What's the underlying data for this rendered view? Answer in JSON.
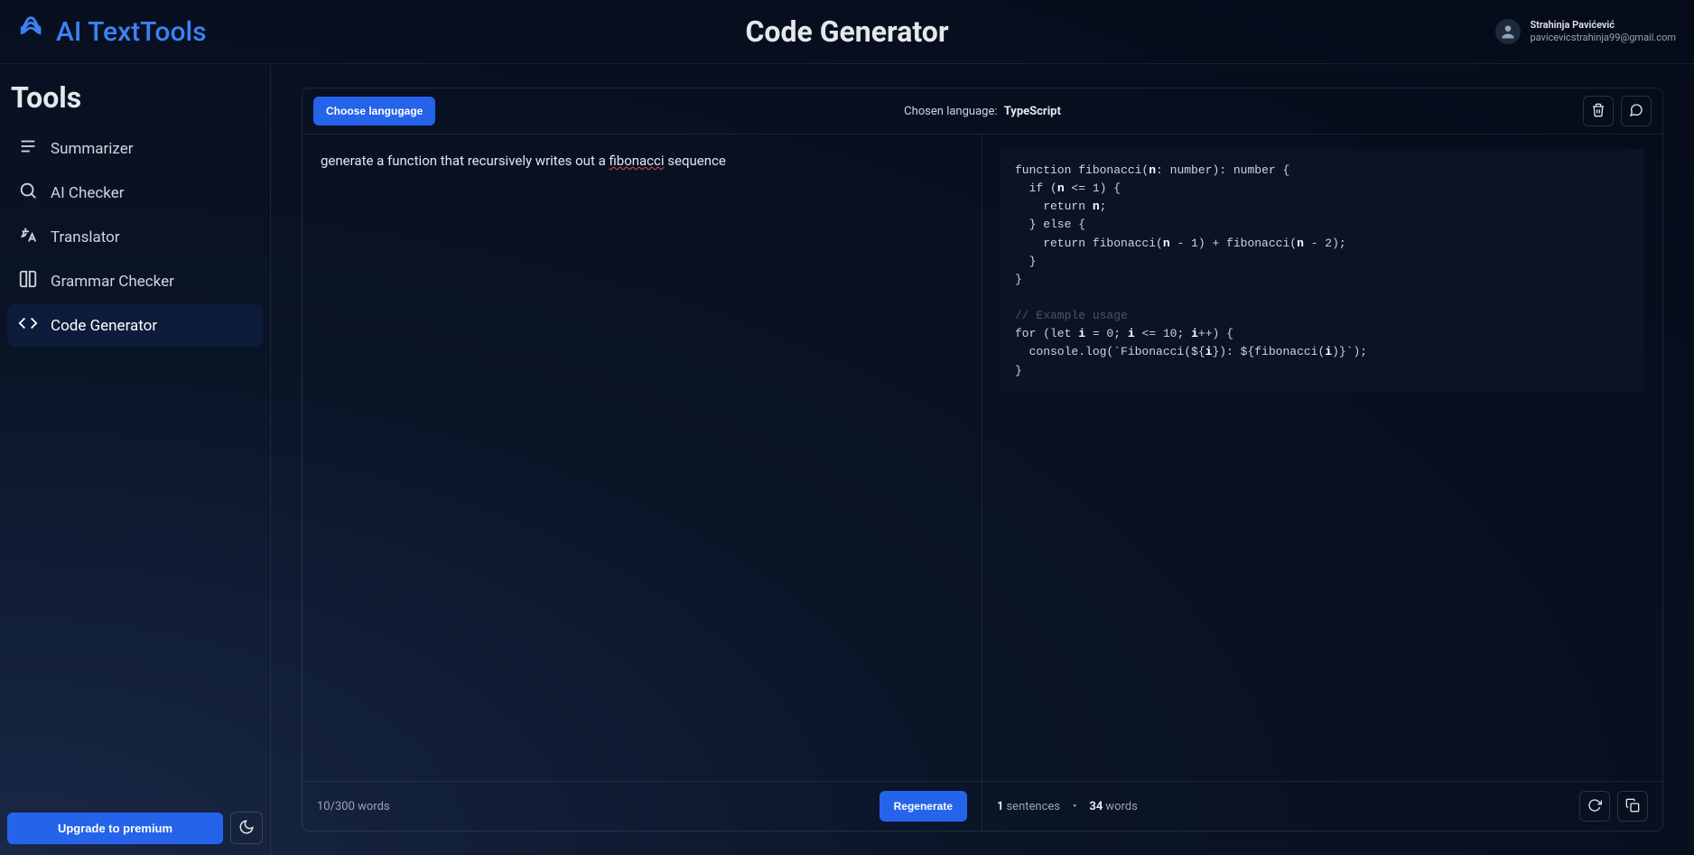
{
  "header": {
    "brand": "AI TextTools",
    "page_title": "Code Generator",
    "user_name": "Strahinja Pavićević",
    "user_email": "pavicevicstrahinja99@gmail.com"
  },
  "sidebar": {
    "title": "Tools",
    "items": [
      {
        "label": "Summarizer",
        "icon": "list-icon"
      },
      {
        "label": "AI Checker",
        "icon": "search-icon"
      },
      {
        "label": "Translator",
        "icon": "translate-icon"
      },
      {
        "label": "Grammar Checker",
        "icon": "book-icon"
      },
      {
        "label": "Code Generator",
        "icon": "code-icon",
        "active": true
      }
    ],
    "upgrade_label": "Upgrade to premium"
  },
  "toolbar": {
    "choose_language_label": "Choose langugage",
    "chosen_language_prefix": "Chosen language:",
    "chosen_language_value": "TypeScript"
  },
  "input": {
    "prompt_plain": "generate a function that recursively writes out a fibonacci sequence",
    "prompt_parts": {
      "pre": "generate a function that recursively writes out a ",
      "err": "fibonacci",
      "post": " sequence"
    },
    "word_counter": "10/300 words",
    "regenerate_label": "Regenerate"
  },
  "output": {
    "code_lines": [
      {
        "kind": "code",
        "text": "function fibonacci(n: number): number {",
        "bold": [
          "n"
        ]
      },
      {
        "kind": "code",
        "text": "  if (n <= 1) {",
        "bold": [
          "n"
        ]
      },
      {
        "kind": "code",
        "text": "    return n;",
        "bold": [
          "n"
        ]
      },
      {
        "kind": "code",
        "text": "  } else {"
      },
      {
        "kind": "code",
        "text": "    return fibonacci(n - 1) + fibonacci(n - 2);",
        "bold": [
          "n"
        ]
      },
      {
        "kind": "code",
        "text": "  }"
      },
      {
        "kind": "code",
        "text": "}"
      },
      {
        "kind": "blank",
        "text": ""
      },
      {
        "kind": "comment",
        "text": "// Example usage"
      },
      {
        "kind": "code",
        "text": "for (let i = 0; i <= 10; i++) {",
        "bold": [
          "i"
        ]
      },
      {
        "kind": "code",
        "text": "  console.log(`Fibonacci(${i}): ${fibonacci(i)}`);",
        "bold": [
          "i"
        ]
      },
      {
        "kind": "code",
        "text": "}"
      }
    ],
    "stats": {
      "sentences_value": "1",
      "sentences_label": "sentences",
      "separator": "•",
      "words_value": "34",
      "words_label": "words"
    }
  },
  "colors": {
    "accent": "#2563eb",
    "bg_dark": "#050b18",
    "code_bg": "#0b1426"
  }
}
